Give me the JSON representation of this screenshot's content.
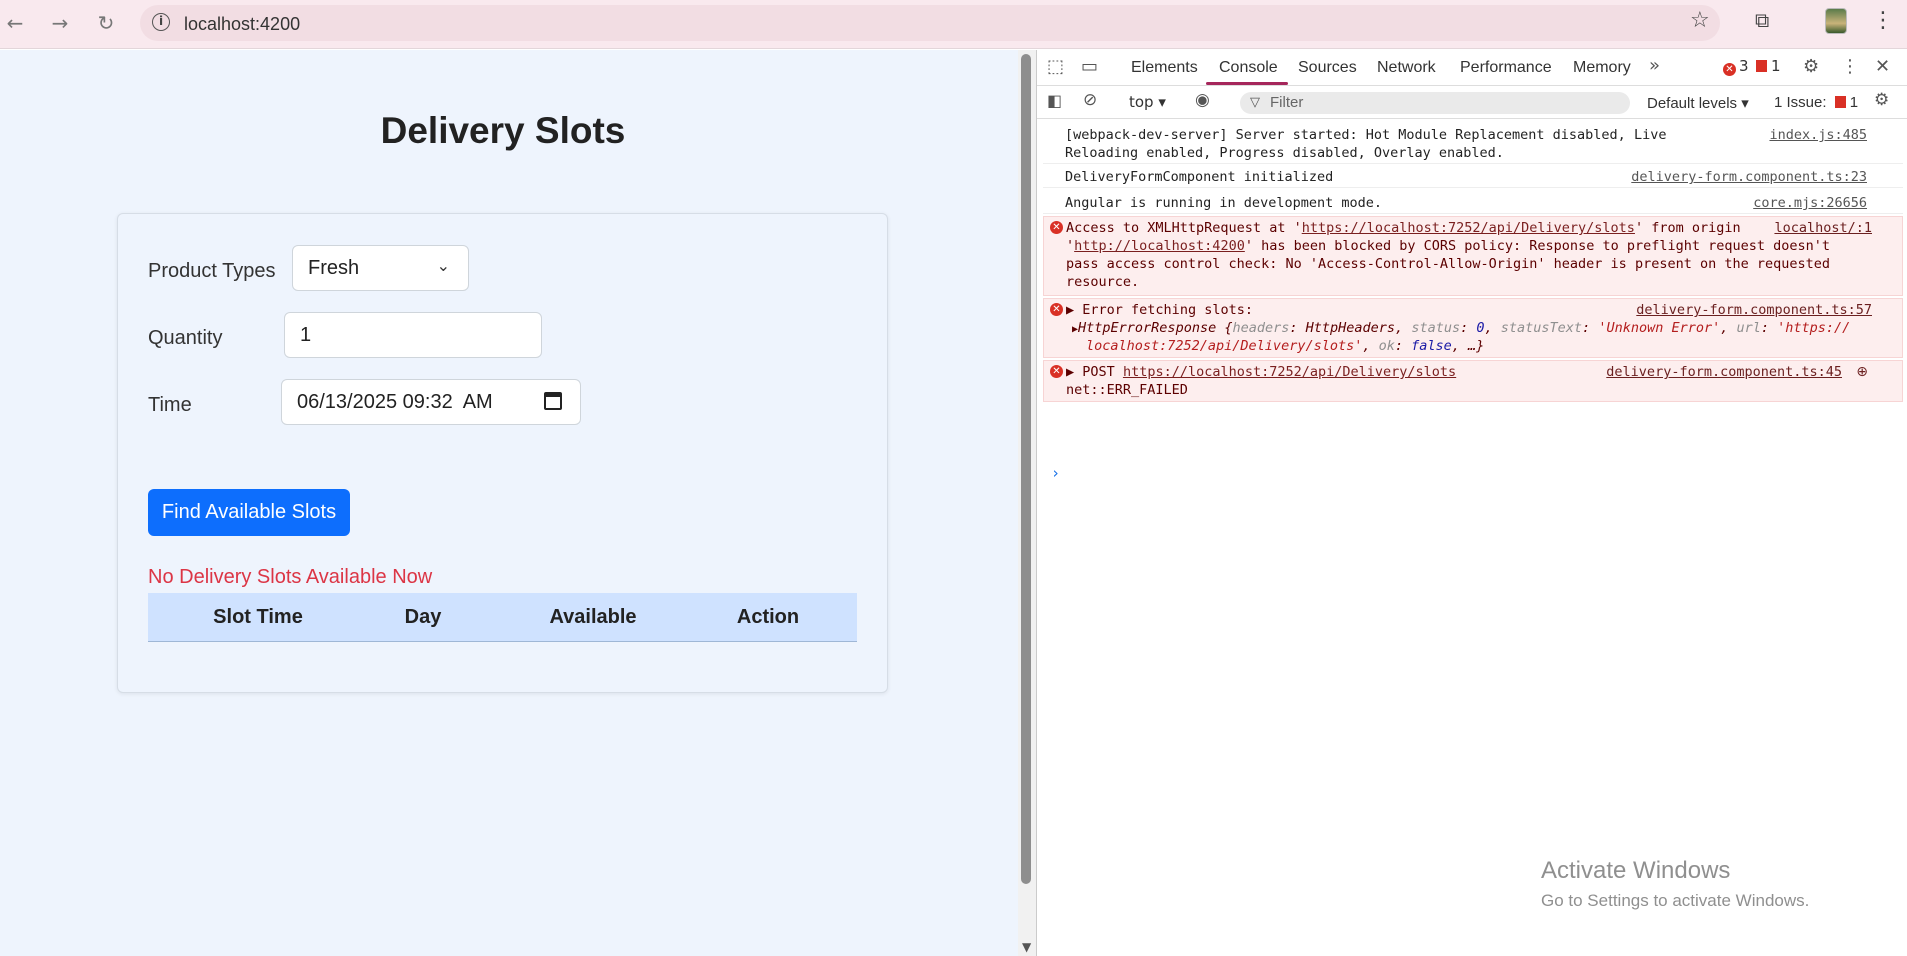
{
  "browser": {
    "url": "localhost:4200"
  },
  "app": {
    "title": "Delivery Slots",
    "product_types_label": "Product Types",
    "product_type_value": "Fresh",
    "quantity_label": "Quantity",
    "quantity_value": "1",
    "time_label": "Time",
    "time_value": "06/13/2025 09:32  AM",
    "find_button": "Find Available Slots",
    "no_slots_message": "No Delivery Slots Available Now",
    "table_headers": [
      "Slot Time",
      "Day",
      "Available",
      "Action"
    ]
  },
  "devtools": {
    "tabs": [
      "Elements",
      "Console",
      "Sources",
      "Network",
      "Performance",
      "Memory"
    ],
    "active_tab": "Console",
    "error_count": "3",
    "issue_count": "1",
    "context": "top ▾",
    "filter_placeholder": "Filter",
    "levels": "Default levels ▾",
    "issues_label": "1 Issue:",
    "issues_count": "1",
    "messages": [
      {
        "text_line1": "[webpack-dev-server] Server started: Hot Module Replacement disabled, Live",
        "text_line2": "Reloading enabled, Progress disabled, Overlay enabled.",
        "source": "index.js:485"
      },
      {
        "text": "DeliveryFormComponent initialized",
        "source": "delivery-form.component.ts:23"
      },
      {
        "text": "Angular is running in development mode.",
        "source": "core.mjs:26656"
      },
      {
        "line1_a": "Access to XMLHttpRequest at '",
        "line1_link": "https://localhost:7252/api/Delivery/slots",
        "line1_b": "' from origin",
        "line2_a": "'",
        "line2_link": "http://localhost:4200",
        "line2_b": "' has been blocked by CORS policy: Response to preflight request doesn't",
        "line3": "pass access control check: No 'Access-Control-Allow-Origin' header is present on the requested",
        "line4": "resource.",
        "source": "localhost/:1"
      },
      {
        "line1": "Error fetching slots:",
        "obj_name": "HttpErrorResponse",
        "obj_rest_a": " {",
        "k_headers": "headers",
        "v_headers": "HttpHeaders",
        "k_status": "status",
        "v_status": "0",
        "k_statusText": "statusText",
        "v_statusText": "'Unknown Error'",
        "k_url": "url",
        "v_url_a": "'https://",
        "v_url_b": "localhost:7252/api/Delivery/slots'",
        "k_ok": "ok",
        "v_ok": "false",
        "tail": ", …}",
        "source": "delivery-form.component.ts:57"
      },
      {
        "method": "POST",
        "link": "https://localhost:7252/api/Delivery/slots",
        "line2": "net::ERR_FAILED",
        "source": "delivery-form.component.ts:45"
      }
    ]
  },
  "watermark": {
    "title": "Activate Windows",
    "subtitle": "Go to Settings to activate Windows."
  }
}
